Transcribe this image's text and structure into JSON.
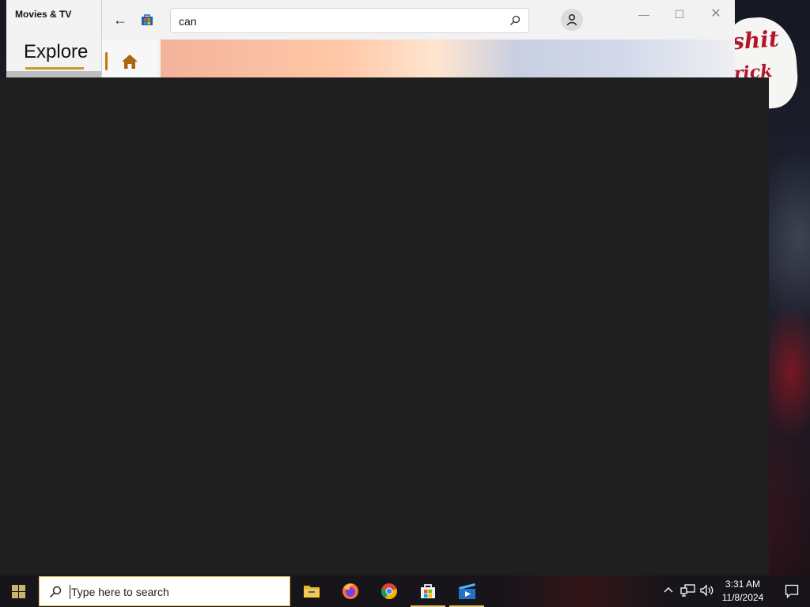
{
  "wallpaper": {
    "sign_line1": "shit",
    "sign_line2": "rick"
  },
  "movies_window": {
    "title": "Movies & TV",
    "nav_label": "Explore",
    "accent_color": "#c59a2b"
  },
  "store_window": {
    "search_value": "can",
    "accent_color": "#c47a00",
    "icons": [
      "back-arrow-icon",
      "store-logo-icon",
      "search-icon",
      "account-icon",
      "minimize-icon",
      "maximize-icon",
      "close-icon",
      "home-icon"
    ],
    "controls": {
      "back": "←",
      "minimize": "—",
      "maximize": "☐",
      "close": "✕"
    }
  },
  "taskbar": {
    "search_placeholder": "Type here to search",
    "apps": [
      "file-explorer-icon",
      "firefox-icon",
      "chrome-icon",
      "microsoft-store-icon",
      "movies-tv-icon"
    ],
    "clock": {
      "time": "3:31 AM",
      "date": "11/8/2024"
    }
  },
  "colors": {
    "overlay": "#1f1f1f",
    "taskbar": "#17151a",
    "search_border": "#e3b442"
  }
}
